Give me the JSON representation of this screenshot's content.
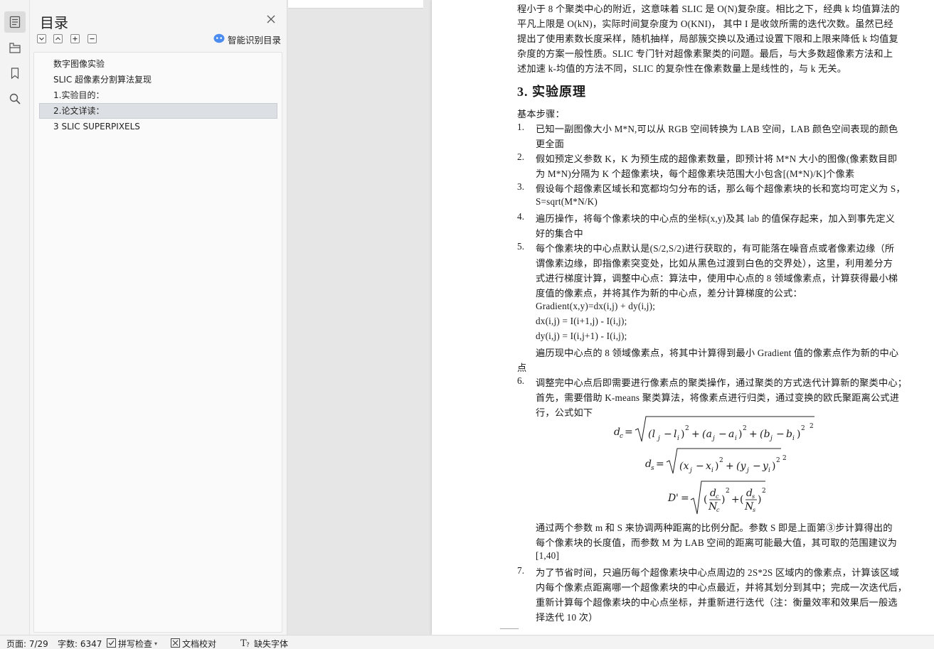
{
  "toc": {
    "title": "目录",
    "smart_label": "智能识别目录",
    "items": [
      "数字图像实验",
      "SLIC 超像素分割算法复现",
      "1.实验目的：",
      "2.论文详读：",
      "3 SLIC SUPERPIXELS"
    ]
  },
  "doc": {
    "intro": [
      "程小于 8 个聚类中心的附近，这意味着 SLIC 是 O(N)复杂度。相比之下，经典 k 均值算法的",
      "平凡上限是  O(kN)，实际时间复杂度为 O(KNI)， 其中 I 是收敛所需的迭代次数。虽然已经",
      "提出了使用素数长度采样，随机抽样，局部簇交换以及通过设置下限和上限来降低 k 均值复",
      "杂度的方案一般性质。SLIC 专门针对超像素聚类的问题。最后，与大多数超像素方法和上",
      "述加速 k-均值的方法不同，SLIC  的复杂性在像素数量上是线性的，与 k 无关。"
    ],
    "heading": "3.  实验原理",
    "steps_label": "基本步骤：",
    "steps": [
      {
        "num": "1.",
        "lines": [
          "已知一副图像大小 M*N,可以从 RGB 空间转换为 LAB 空间，LAB 颜色空间表现的颜色",
          "更全面"
        ]
      },
      {
        "num": "2.",
        "lines": [
          "假如预定义参数 K，K 为预生成的超像素数量，即预计将 M*N 大小的图像(像素数目即",
          "为 M*N)分隔为 K 个超像素块，每个超像素块范围大小包含[(M*N)/K]个像素"
        ]
      },
      {
        "num": "3.",
        "lines": [
          "假设每个超像素区域长和宽都均匀分布的话，那么每个超像素块的长和宽均可定义为 S，",
          "S=sqrt(M*N/K)"
        ]
      },
      {
        "num": "4.",
        "lines": [
          "遍历操作，将每个像素块的中心点的坐标(x,y)及其 lab 的值保存起来，加入到事先定义",
          "好的集合中"
        ]
      },
      {
        "num": "5.",
        "lines": [
          "每个像素块的中心点默认是(S/2,S/2)进行获取的，有可能落在噪音点或者像素边缘（所",
          "谓像素边缘，即指像素突变处，比如从黑色过渡到白色的交界处），这里，利用差分方",
          "式进行梯度计算，调整中心点：算法中，使用中心点的 8 领域像素点，计算获得最小梯",
          "度值的像素点，并将其作为新的中心点，差分计算梯度的公式：",
          "Gradient(x,y)=dx(i,j) + dy(i,j);",
          "dx(i,j) = I(i+1,j) - I(i,j);",
          "dy(i,j) = I(i,j+1) - I(i,j);",
          "遍历现中心点的 8 领域像素点，将其中计算得到最小 Gradient 值的像素点作为新的中心"
        ]
      },
      {
        "num": "6.",
        "lines": [
          "调整完中心点后即需要进行像素点的聚类操作，通过聚类的方式迭代计算新的聚类中心；",
          "首先，需要借助 K-means 聚类算法，将像素点进行归类，通过变换的欧氏聚距离公式进",
          "行，公式如下"
        ]
      },
      {
        "num": "7.",
        "lines": [
          "为了节省时间，只遍历每个超像素块中心点周边的 2S*2S 区域内的像素点，计算该区域",
          "内每个像素点距离哪一个超像素块的中心点最近，并将其划分到其中；完成一次迭代后，",
          "重新计算每个超像素块的中心点坐标，并重新进行迭代（注：衡量效率和效果后一般选",
          "择迭代 10 次）"
        ]
      }
    ],
    "step5_tail": "点",
    "after_formula": [
      "通过两个参数 m 和 S 来协调两种距离的比例分配。参数 S 即是上面第③步计算得出的",
      "每个像素块的长度值，而参数 M 为 LAB 空间的距离可能最大值，其可取的范围建议为",
      "[1,40]"
    ]
  },
  "status": {
    "page": "页面: 7/29",
    "words": "字数: 6347",
    "spell": "拼写检查",
    "proof": "文档校对",
    "missing_font": "缺失字体"
  }
}
